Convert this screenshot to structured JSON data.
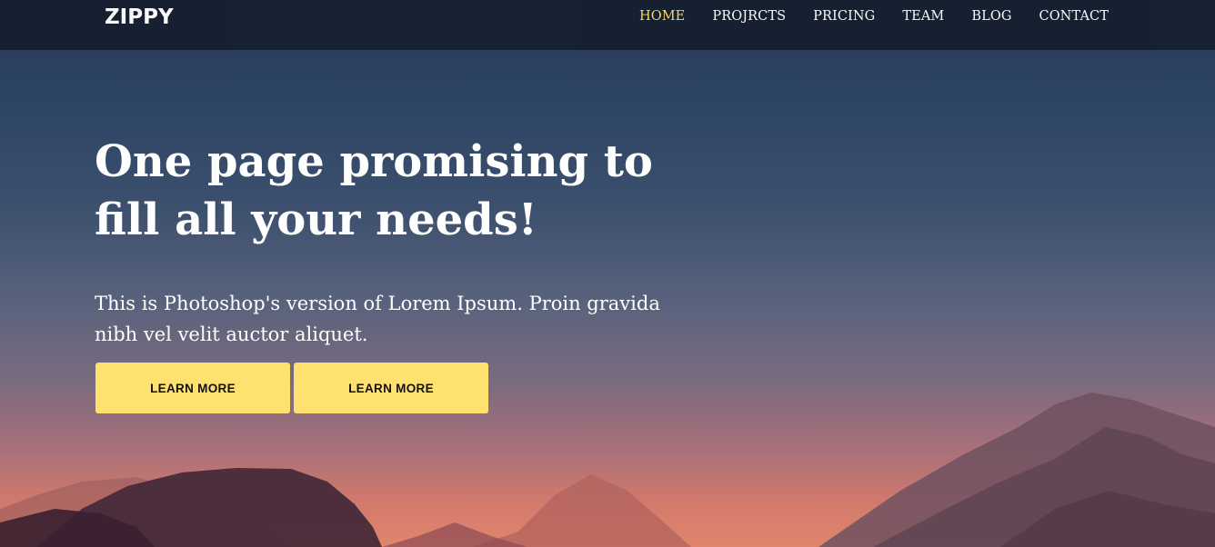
{
  "header": {
    "logo": "ZIPPY",
    "nav": [
      {
        "label": "HOME",
        "active": true
      },
      {
        "label": "PROJRCTS",
        "active": false
      },
      {
        "label": "PRICING",
        "active": false
      },
      {
        "label": "TEAM",
        "active": false
      },
      {
        "label": "BLOG",
        "active": false
      },
      {
        "label": "CONTACT",
        "active": false
      }
    ]
  },
  "hero": {
    "headline": "One page promising to fill all your needs!",
    "subtext": "This is Photoshop's version of Lorem Ipsum. Proin gravida nibh vel velit auctor aliquet.",
    "buttons": [
      {
        "label": "LEARN MORE"
      },
      {
        "label": "LEARN MORE"
      }
    ]
  },
  "colors": {
    "nav_bg": "#16202f",
    "nav_active": "#ffd966",
    "button_bg": "#ffe170",
    "sky_top": "#263a57",
    "sky_bottom": "#e1856d"
  }
}
